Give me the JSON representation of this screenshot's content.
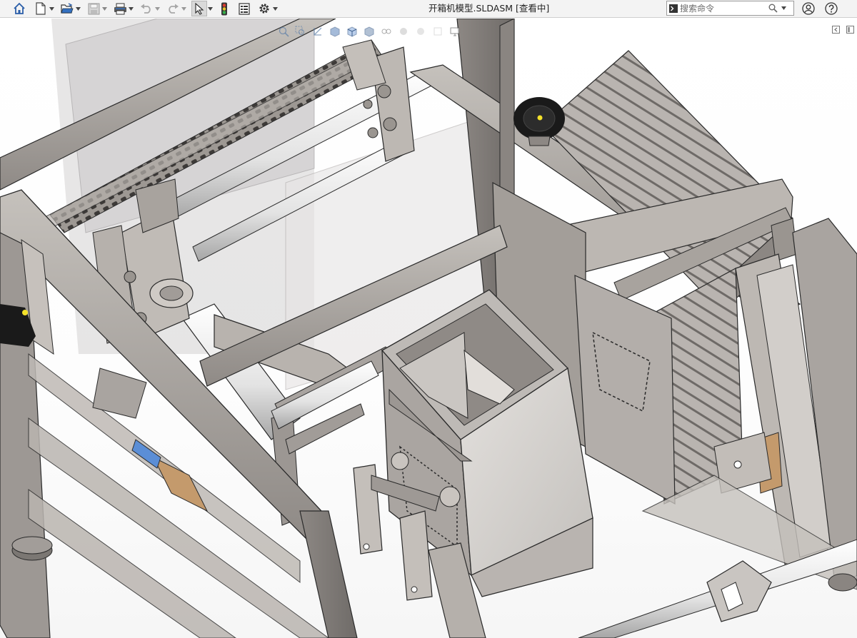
{
  "window": {
    "title": "开箱机模型.SLDASM [查看中]"
  },
  "toolbar": {
    "items": [
      {
        "icon": "home-icon"
      },
      {
        "icon": "new-document-icon"
      },
      {
        "icon": "open-folder-icon"
      },
      {
        "icon": "save-icon"
      },
      {
        "icon": "print-icon"
      },
      {
        "icon": "undo-icon"
      },
      {
        "icon": "redo-icon"
      },
      {
        "icon": "select-pointer-icon"
      },
      {
        "icon": "rebuild-traffic-light-icon"
      },
      {
        "icon": "file-properties-icon"
      },
      {
        "icon": "options-gear-icon"
      }
    ]
  },
  "search": {
    "placeholder": "搜索命令"
  },
  "right_icons": [
    "user-account-icon",
    "help-icon"
  ],
  "heads_up_toolbar": {
    "icons": [
      "zoom-to-fit-icon",
      "zoom-to-area-icon",
      "previous-view-icon",
      "section-view-icon",
      "view-orientation-icon",
      "display-style-icon",
      "hide-show-items-icon",
      "edit-appearance-icon",
      "apply-scene-icon",
      "view-settings-icon",
      "monitor-icon"
    ]
  },
  "colors": {
    "toolbar_bg": "#f3f3f3",
    "model_gray": "#a9a4a0",
    "model_shadow": "#6f6b68",
    "edge": "#2a2a2a",
    "copper": "#c49a6c",
    "knob": "#1a1a1a",
    "knob_center": "#f4e12a"
  }
}
